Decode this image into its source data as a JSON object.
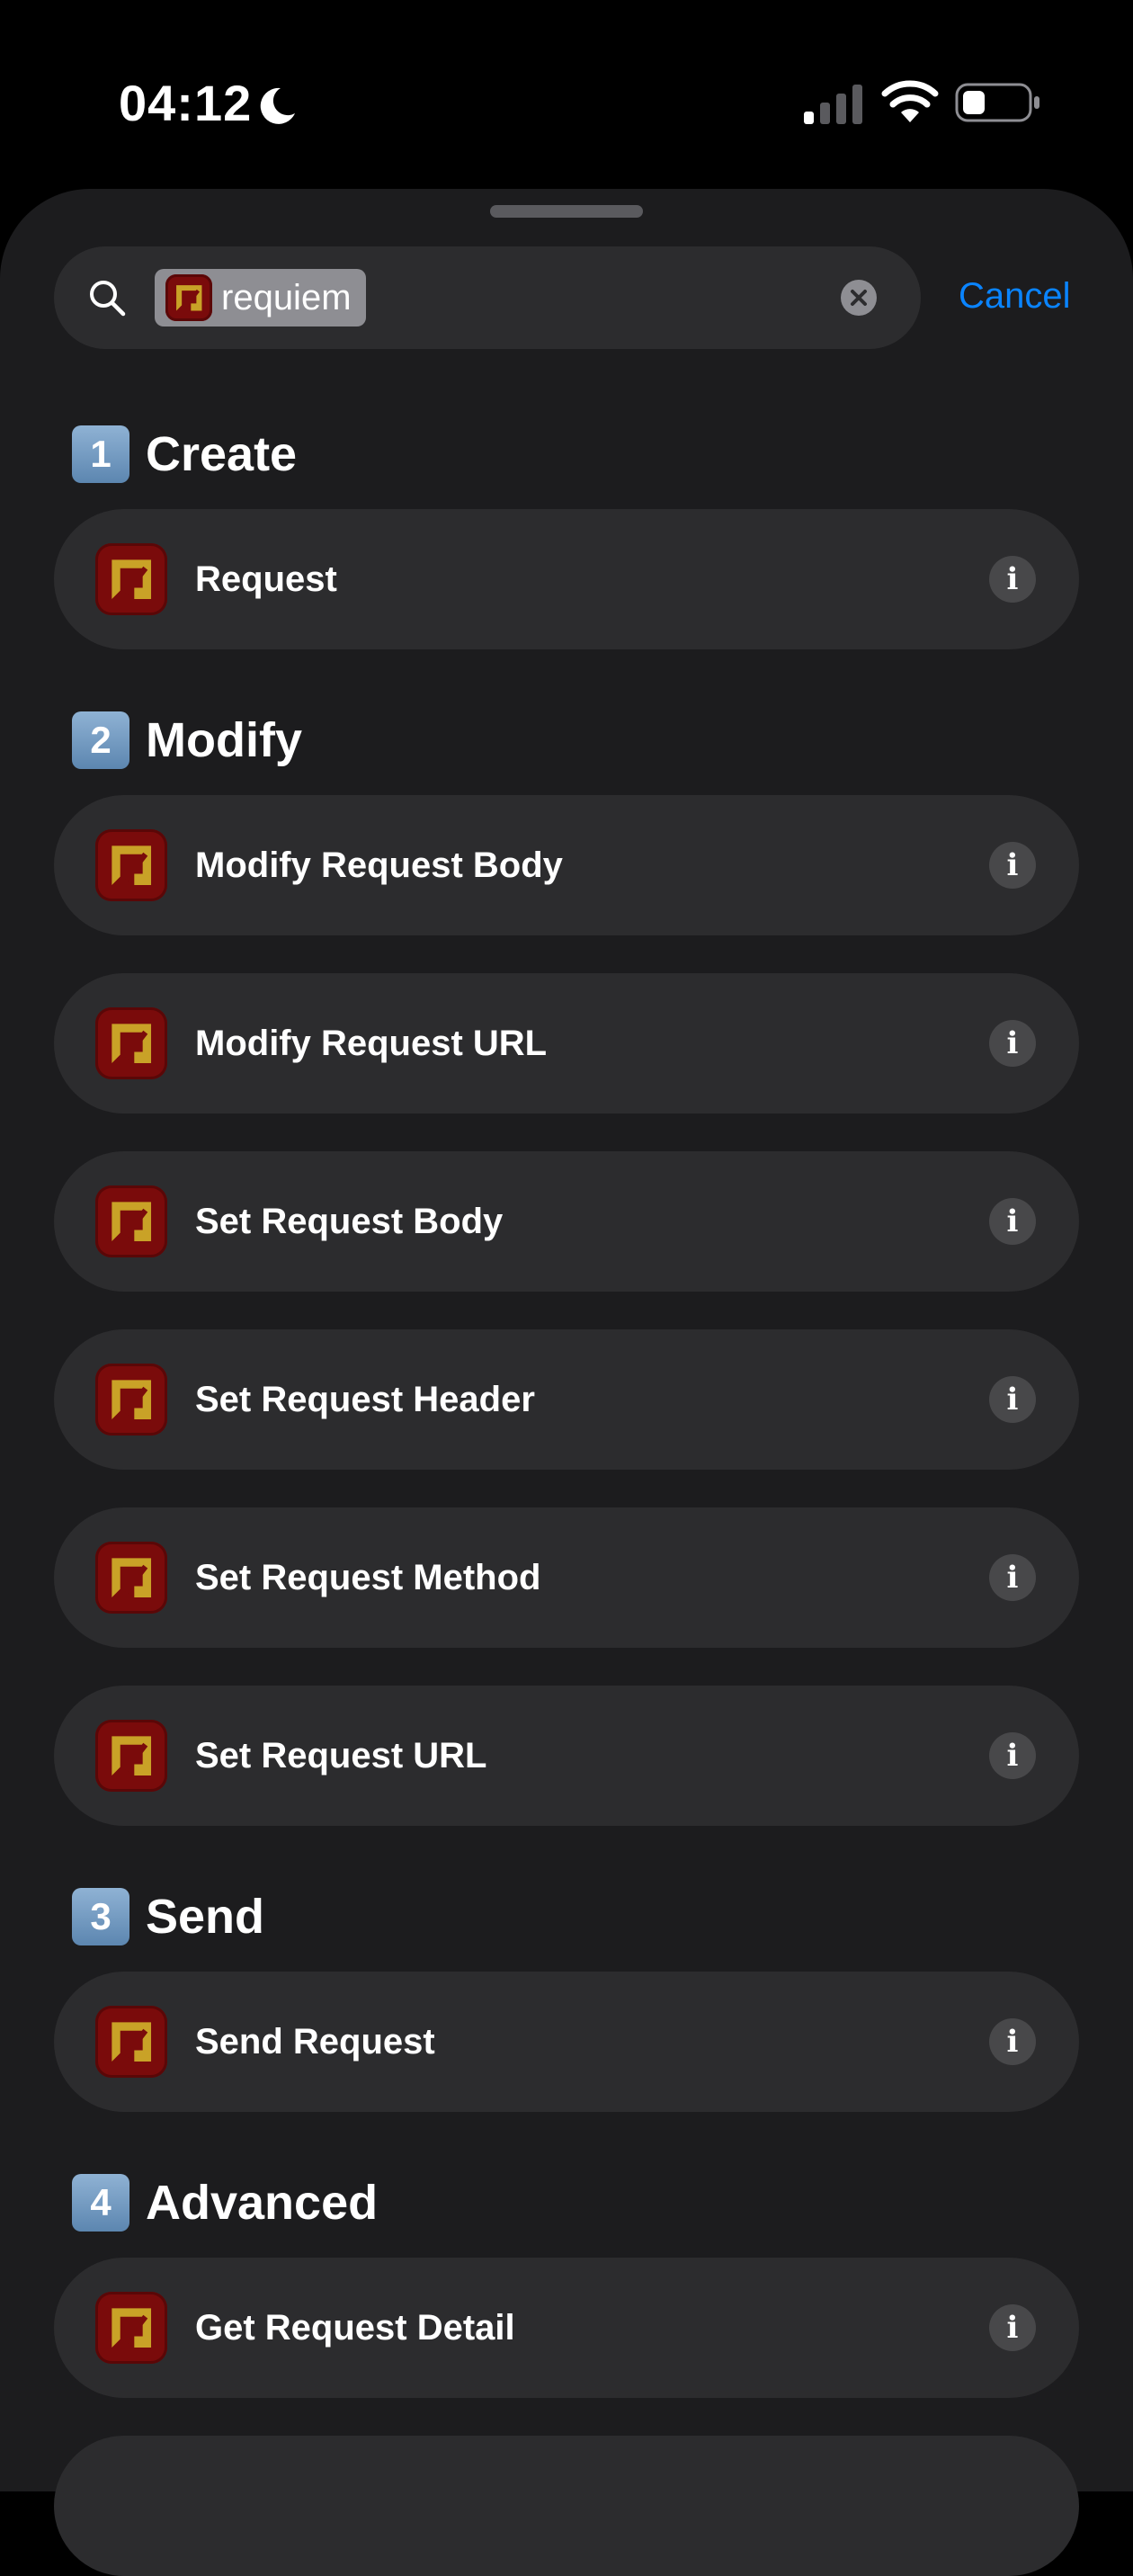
{
  "status_bar": {
    "time": "04:12"
  },
  "search": {
    "token_text": "requiem",
    "cancel_label": "Cancel"
  },
  "sections": [
    {
      "number": "1",
      "title": "Create",
      "items": [
        {
          "label": "Request"
        }
      ]
    },
    {
      "number": "2",
      "title": "Modify",
      "items": [
        {
          "label": "Modify Request Body"
        },
        {
          "label": "Modify Request URL"
        },
        {
          "label": "Set Request Body"
        },
        {
          "label": "Set Request Header"
        },
        {
          "label": "Set Request Method"
        },
        {
          "label": "Set Request URL"
        }
      ]
    },
    {
      "number": "3",
      "title": "Send",
      "items": [
        {
          "label": "Send Request"
        }
      ]
    },
    {
      "number": "4",
      "title": "Advanced",
      "items": [
        {
          "label": "Get Request Detail"
        }
      ]
    }
  ],
  "info_glyph": "i",
  "icons": {
    "app": "requiem-app-icon",
    "search": "search-icon",
    "clear": "clear-icon",
    "info": "info-icon"
  },
  "colors": {
    "sheet_background": "#1c1c1e",
    "row_background": "#2c2c2e",
    "accent": "#0a84ff",
    "app_icon_red": "#7a0b0b",
    "app_icon_gold": "#c9a227"
  }
}
